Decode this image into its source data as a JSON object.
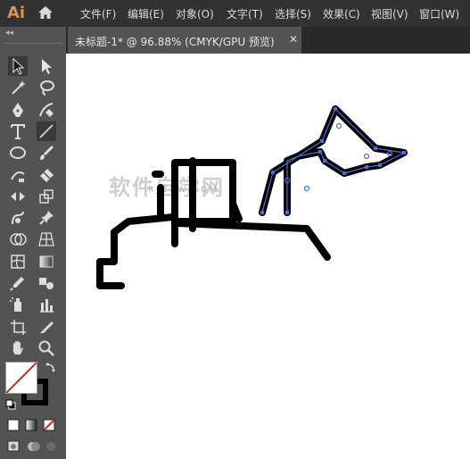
{
  "app": {
    "logo": "Ai"
  },
  "menu": [
    "文件(F)",
    "编辑(E)",
    "对象(O)",
    "文字(T)",
    "选择(S)",
    "效果(C)",
    "视图(V)",
    "窗口(W)"
  ],
  "document_tab": {
    "title": "未标题-1* @ 96.88% (CMYK/GPU 预览)",
    "close": "✕"
  },
  "panel_collapse": "◂◂",
  "watermark": {
    "text": "软件自学网",
    "sub": "RJZXW.COM"
  },
  "colors": {
    "menubar": "#323232",
    "panel": "#535353",
    "canvas": "#ffffff",
    "selection": "#4b6fd7",
    "stroke": "#000000"
  },
  "tools": [
    "selection-tool",
    "direct-selection-tool",
    "magic-wand-tool",
    "lasso-tool",
    "pen-tool",
    "curvature-tool",
    "type-tool",
    "line-segment-tool",
    "ellipse-tool",
    "paintbrush-tool",
    "shaper-tool",
    "eraser-tool",
    "width-tool",
    "scale-tool",
    "puppet-warp-tool",
    "pin-tool",
    "shape-builder-tool",
    "perspective-grid-tool",
    "mesh-tool",
    "gradient-tool",
    "eyedropper-tool",
    "blend-tool",
    "symbol-sprayer-tool",
    "column-graph-tool",
    "artboard-tool",
    "slice-tool",
    "hand-tool",
    "zoom-tool"
  ]
}
